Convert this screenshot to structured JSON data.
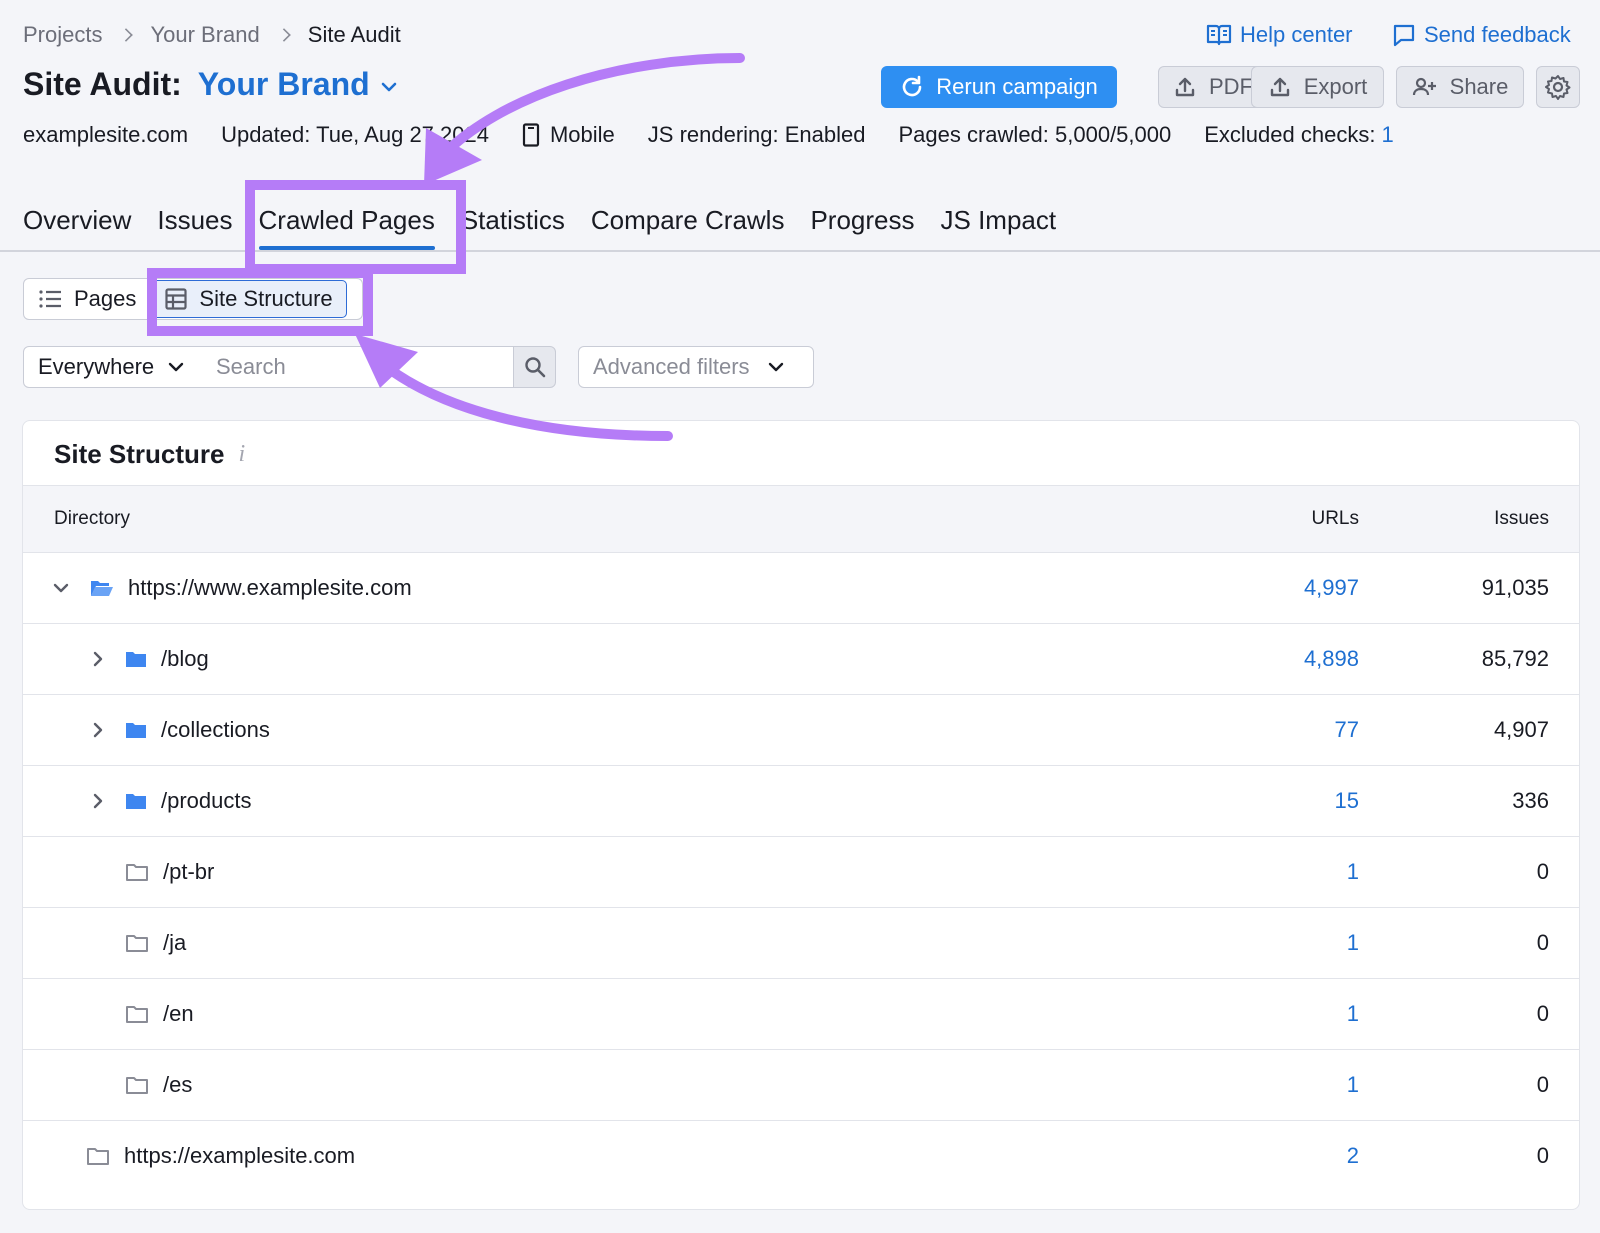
{
  "breadcrumb": [
    "Projects",
    "Your Brand",
    "Site Audit"
  ],
  "top_links": {
    "help": "Help center",
    "feedback": "Send feedback"
  },
  "title": {
    "label": "Site Audit:",
    "brand": "Your Brand"
  },
  "buttons": {
    "rerun": "Rerun campaign",
    "pdf": "PDF",
    "export": "Export",
    "share": "Share"
  },
  "meta": {
    "domain": "examplesite.com",
    "updated": "Updated: Tue, Aug 27 2024",
    "device": "Mobile",
    "js_rendering": "JS rendering: Enabled",
    "pages_crawled": "Pages crawled: 5,000/5,000",
    "excluded_label": "Excluded checks:",
    "excluded_value": "1"
  },
  "tabs": [
    "Overview",
    "Issues",
    "Crawled Pages",
    "Statistics",
    "Compare Crawls",
    "Progress",
    "JS Impact"
  ],
  "active_tab": "Crawled Pages",
  "view_toggle": {
    "pages": "Pages",
    "site_structure": "Site Structure",
    "selected": "Site Structure"
  },
  "filters": {
    "scope": "Everywhere",
    "search_placeholder": "Search",
    "advanced": "Advanced filters"
  },
  "table": {
    "title": "Site Structure",
    "info": "i",
    "columns": {
      "directory": "Directory",
      "urls": "URLs",
      "issues": "Issues"
    },
    "rows": [
      {
        "directory": "https://www.examplesite.com",
        "urls": "4,997",
        "issues": "91,035"
      },
      {
        "directory": "/blog",
        "urls": "4,898",
        "issues": "85,792"
      },
      {
        "directory": "/collections",
        "urls": "77",
        "issues": "4,907"
      },
      {
        "directory": "/products",
        "urls": "15",
        "issues": "336"
      },
      {
        "directory": "/pt-br",
        "urls": "1",
        "issues": "0"
      },
      {
        "directory": "/ja",
        "urls": "1",
        "issues": "0"
      },
      {
        "directory": "/en",
        "urls": "1",
        "issues": "0"
      },
      {
        "directory": "/es",
        "urls": "1",
        "issues": "0"
      },
      {
        "directory": "https://examplesite.com",
        "urls": "2",
        "issues": "0"
      }
    ]
  },
  "colors": {
    "accent": "#1e6fd1",
    "primary_button": "#2e8ff2",
    "annotation": "#b57cf7",
    "folder": "#3e86f0"
  }
}
